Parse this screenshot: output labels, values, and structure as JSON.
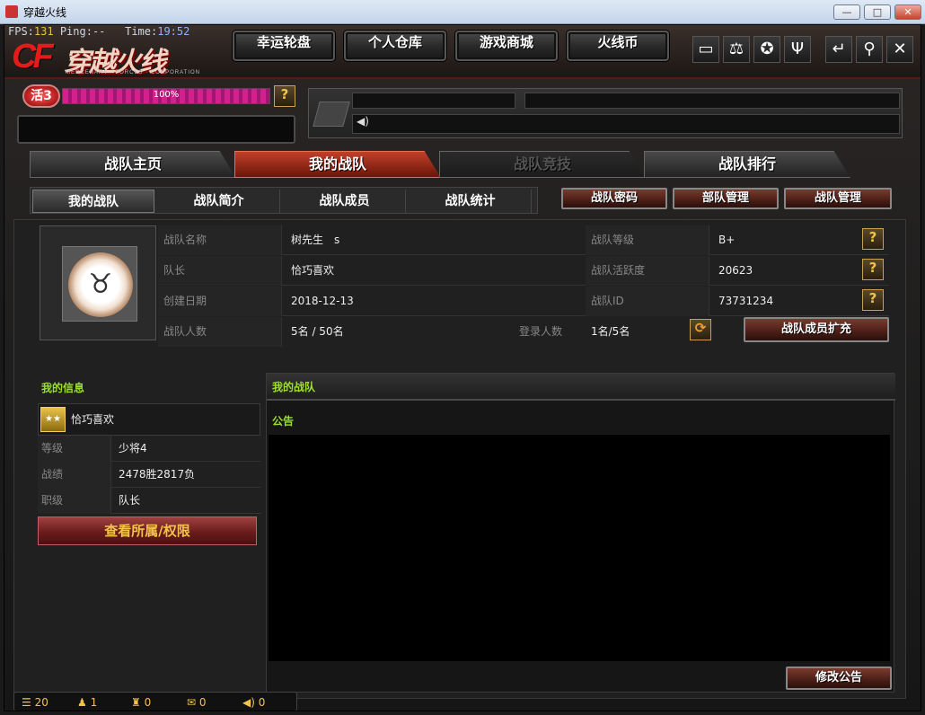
{
  "window": {
    "title": "穿越火线",
    "buttons": {
      "min": "—",
      "max": "□",
      "close": "✕"
    }
  },
  "hud": {
    "fps_label": "FPS:",
    "fps_value": "131",
    "ping_label": "Ping:",
    "ping_value": "--",
    "time_label": "Time:",
    "time_value": "19:52"
  },
  "logo": {
    "cf": "CF",
    "cn": "穿越火线",
    "sub": "MERCENARY · FORCES · CORPORATION"
  },
  "topnav": [
    "幸运轮盘",
    "个人仓库",
    "游戏商城",
    "火线币"
  ],
  "topicons": [
    "tv-icon",
    "scale-icon",
    "badge-icon",
    "trophy-icon",
    "back-icon",
    "wrench-icon",
    "close-icon"
  ],
  "activity": {
    "badge": "活3",
    "percent_label": "100%",
    "progress": 1.0,
    "help": "?"
  },
  "main_tabs": [
    {
      "label": "战队主页",
      "state": "normal"
    },
    {
      "label": "我的战队",
      "state": "active"
    },
    {
      "label": "战队竞技",
      "state": "disabled"
    },
    {
      "label": "战队排行",
      "state": "normal"
    }
  ],
  "sub_tabs": [
    "我的战队",
    "战队简介",
    "战队成员",
    "战队统计"
  ],
  "sub_buttons": [
    "战队密码",
    "部队管理",
    "战队管理"
  ],
  "team_info": {
    "name_label": "战队名称",
    "name": "树先生　s",
    "captain_label": "队长",
    "captain": "恰巧喜欢",
    "created_label": "创建日期",
    "created": "2018-12-13",
    "members_label": "战队人数",
    "members": "5名 / 50名",
    "login_label": "登录人数",
    "login": "1名/5名",
    "level_label": "战队等级",
    "level": "B+",
    "activity_label": "战队活跃度",
    "activity": "20623",
    "id_label": "战队ID",
    "id": "73731234",
    "expand_button": "战队成员扩充"
  },
  "my_info": {
    "title": "我的信息",
    "name": "恰巧喜欢",
    "rows": [
      {
        "label": "等级",
        "value": "少将4"
      },
      {
        "label": "战绩",
        "value": "2478胜2817负"
      },
      {
        "label": "职级",
        "value": "队长"
      }
    ],
    "button": "查看所属/权限"
  },
  "my_team": {
    "title": "我的战队",
    "notice_label": "公告",
    "edit_button": "修改公告"
  },
  "status": [
    {
      "icon": "list-icon",
      "value": "20"
    },
    {
      "icon": "person-icon",
      "value": "1"
    },
    {
      "icon": "team-icon",
      "value": "0"
    },
    {
      "icon": "chat-icon",
      "value": "0"
    },
    {
      "icon": "speaker-icon",
      "value": "0"
    }
  ]
}
